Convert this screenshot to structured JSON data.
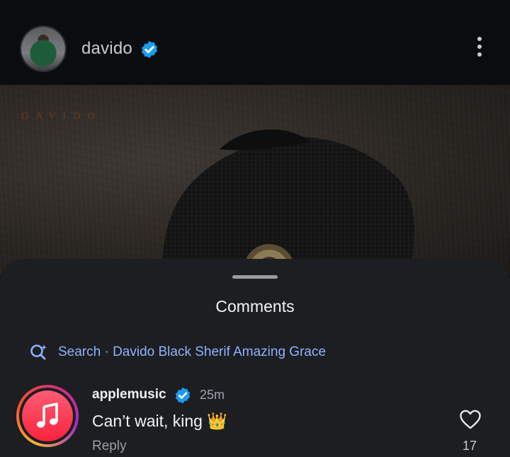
{
  "header": {
    "username": "davido",
    "more_icon": "more-vertical-icon"
  },
  "post": {
    "brand_text": "DAVIDO"
  },
  "comments_sheet": {
    "title": "Comments",
    "search_label": "Search · Davido Black Sherif Amazing Grace",
    "comment": {
      "username": "applemusic",
      "time": "25m",
      "text": "Can’t wait, king 👑",
      "reply_label": "Reply",
      "like_count": "17"
    }
  },
  "colors": {
    "verified": "#1d9bf0",
    "link_blue": "#8fb3ff",
    "sheet_bg": "#1c1e21",
    "apple_music_red": "#fa233b"
  }
}
